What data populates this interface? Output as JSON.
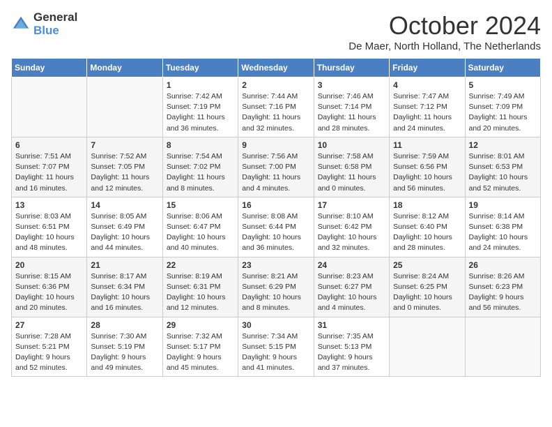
{
  "header": {
    "logo_line1": "General",
    "logo_line2": "Blue",
    "month": "October 2024",
    "location": "De Maer, North Holland, The Netherlands"
  },
  "weekdays": [
    "Sunday",
    "Monday",
    "Tuesday",
    "Wednesday",
    "Thursday",
    "Friday",
    "Saturday"
  ],
  "weeks": [
    [
      {
        "day": "",
        "info": ""
      },
      {
        "day": "",
        "info": ""
      },
      {
        "day": "1",
        "info": "Sunrise: 7:42 AM\nSunset: 7:19 PM\nDaylight: 11 hours\nand 36 minutes."
      },
      {
        "day": "2",
        "info": "Sunrise: 7:44 AM\nSunset: 7:16 PM\nDaylight: 11 hours\nand 32 minutes."
      },
      {
        "day": "3",
        "info": "Sunrise: 7:46 AM\nSunset: 7:14 PM\nDaylight: 11 hours\nand 28 minutes."
      },
      {
        "day": "4",
        "info": "Sunrise: 7:47 AM\nSunset: 7:12 PM\nDaylight: 11 hours\nand 24 minutes."
      },
      {
        "day": "5",
        "info": "Sunrise: 7:49 AM\nSunset: 7:09 PM\nDaylight: 11 hours\nand 20 minutes."
      }
    ],
    [
      {
        "day": "6",
        "info": "Sunrise: 7:51 AM\nSunset: 7:07 PM\nDaylight: 11 hours\nand 16 minutes."
      },
      {
        "day": "7",
        "info": "Sunrise: 7:52 AM\nSunset: 7:05 PM\nDaylight: 11 hours\nand 12 minutes."
      },
      {
        "day": "8",
        "info": "Sunrise: 7:54 AM\nSunset: 7:02 PM\nDaylight: 11 hours\nand 8 minutes."
      },
      {
        "day": "9",
        "info": "Sunrise: 7:56 AM\nSunset: 7:00 PM\nDaylight: 11 hours\nand 4 minutes."
      },
      {
        "day": "10",
        "info": "Sunrise: 7:58 AM\nSunset: 6:58 PM\nDaylight: 11 hours\nand 0 minutes."
      },
      {
        "day": "11",
        "info": "Sunrise: 7:59 AM\nSunset: 6:56 PM\nDaylight: 10 hours\nand 56 minutes."
      },
      {
        "day": "12",
        "info": "Sunrise: 8:01 AM\nSunset: 6:53 PM\nDaylight: 10 hours\nand 52 minutes."
      }
    ],
    [
      {
        "day": "13",
        "info": "Sunrise: 8:03 AM\nSunset: 6:51 PM\nDaylight: 10 hours\nand 48 minutes."
      },
      {
        "day": "14",
        "info": "Sunrise: 8:05 AM\nSunset: 6:49 PM\nDaylight: 10 hours\nand 44 minutes."
      },
      {
        "day": "15",
        "info": "Sunrise: 8:06 AM\nSunset: 6:47 PM\nDaylight: 10 hours\nand 40 minutes."
      },
      {
        "day": "16",
        "info": "Sunrise: 8:08 AM\nSunset: 6:44 PM\nDaylight: 10 hours\nand 36 minutes."
      },
      {
        "day": "17",
        "info": "Sunrise: 8:10 AM\nSunset: 6:42 PM\nDaylight: 10 hours\nand 32 minutes."
      },
      {
        "day": "18",
        "info": "Sunrise: 8:12 AM\nSunset: 6:40 PM\nDaylight: 10 hours\nand 28 minutes."
      },
      {
        "day": "19",
        "info": "Sunrise: 8:14 AM\nSunset: 6:38 PM\nDaylight: 10 hours\nand 24 minutes."
      }
    ],
    [
      {
        "day": "20",
        "info": "Sunrise: 8:15 AM\nSunset: 6:36 PM\nDaylight: 10 hours\nand 20 minutes."
      },
      {
        "day": "21",
        "info": "Sunrise: 8:17 AM\nSunset: 6:34 PM\nDaylight: 10 hours\nand 16 minutes."
      },
      {
        "day": "22",
        "info": "Sunrise: 8:19 AM\nSunset: 6:31 PM\nDaylight: 10 hours\nand 12 minutes."
      },
      {
        "day": "23",
        "info": "Sunrise: 8:21 AM\nSunset: 6:29 PM\nDaylight: 10 hours\nand 8 minutes."
      },
      {
        "day": "24",
        "info": "Sunrise: 8:23 AM\nSunset: 6:27 PM\nDaylight: 10 hours\nand 4 minutes."
      },
      {
        "day": "25",
        "info": "Sunrise: 8:24 AM\nSunset: 6:25 PM\nDaylight: 10 hours\nand 0 minutes."
      },
      {
        "day": "26",
        "info": "Sunrise: 8:26 AM\nSunset: 6:23 PM\nDaylight: 9 hours\nand 56 minutes."
      }
    ],
    [
      {
        "day": "27",
        "info": "Sunrise: 7:28 AM\nSunset: 5:21 PM\nDaylight: 9 hours\nand 52 minutes."
      },
      {
        "day": "28",
        "info": "Sunrise: 7:30 AM\nSunset: 5:19 PM\nDaylight: 9 hours\nand 49 minutes."
      },
      {
        "day": "29",
        "info": "Sunrise: 7:32 AM\nSunset: 5:17 PM\nDaylight: 9 hours\nand 45 minutes."
      },
      {
        "day": "30",
        "info": "Sunrise: 7:34 AM\nSunset: 5:15 PM\nDaylight: 9 hours\nand 41 minutes."
      },
      {
        "day": "31",
        "info": "Sunrise: 7:35 AM\nSunset: 5:13 PM\nDaylight: 9 hours\nand 37 minutes."
      },
      {
        "day": "",
        "info": ""
      },
      {
        "day": "",
        "info": ""
      }
    ]
  ]
}
